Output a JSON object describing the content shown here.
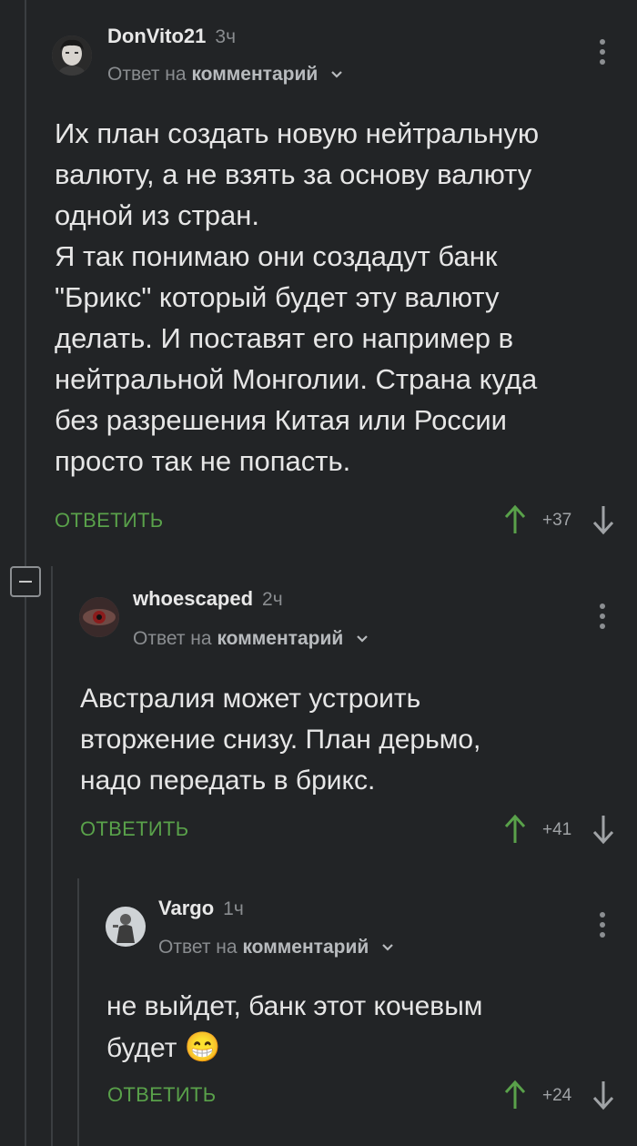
{
  "colors": {
    "background": "#222426",
    "accent_green": "#59a14a",
    "thread_line": "#3b3e41",
    "muted": "#8a8d90"
  },
  "icons": {
    "upvote": "arrow-up-icon",
    "downvote": "arrow-down-icon",
    "menu": "more-vertical-icon",
    "collapse": "minus-square-icon",
    "chevron": "chevron-down-icon"
  },
  "comments": [
    {
      "author": "DonVito21",
      "time": "3ч",
      "reply_prefix": "Ответ на",
      "reply_target": "комментарий",
      "text": "Их план создать новую нейтральную\nвалюту, а не взять за основу валюту\nодной из стран.\nЯ так понимаю они создадут банк\n\"Брикс\" который будет эту валюту\nделать. И поставят его например в\nнейтральной Монголии. Страна куда\nбез разрешения Китая или России\nпросто так не попасть.",
      "reply_label": "ОТВЕТИТЬ",
      "score": "+37"
    },
    {
      "author": "whoescaped",
      "time": "2ч",
      "reply_prefix": "Ответ на",
      "reply_target": "комментарий",
      "text": "Австралия может устроить\nвторжение снизу. План дерьмо,\nнадо передать в брикс.",
      "reply_label": "ОТВЕТИТЬ",
      "score": "+41"
    },
    {
      "author": "Vargo",
      "time": "1ч",
      "reply_prefix": "Ответ на",
      "reply_target": "комментарий",
      "text": "не выйдет, банк этот кочевым\nбудет",
      "emoji": "😁",
      "reply_label": "ОТВЕТИТЬ",
      "score": "+24"
    }
  ]
}
